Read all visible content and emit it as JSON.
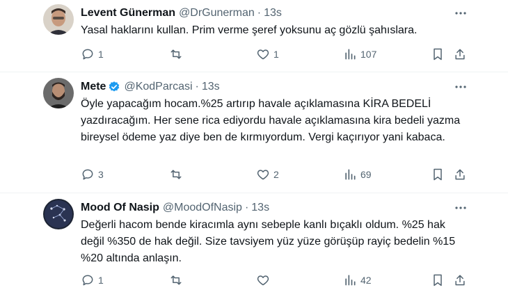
{
  "tweets": [
    {
      "name": "Levent Günerman",
      "handle": "@DrGunerman",
      "dot": "·",
      "time": "13s",
      "lines": [
        "Yasal haklarını kullan. Prim verme şeref yoksunu aç gözlü şahıslara."
      ],
      "replies": "1",
      "retweets": "",
      "likes": "1",
      "views": "107",
      "avatar_color": "#8a6a55"
    },
    {
      "name": "Mete",
      "handle": "@KodParcasi",
      "dot": "·",
      "time": "13s",
      "lines": [
        "Öyle yapacağım hocam.%25 artırıp havale açıklamasına KİRA BEDELİ",
        "yazdıracağım. Her sene rica ediyordu havale açıklamasına kira bedeli yazma",
        "bireysel ödeme yaz diye ben de kırmıyordum. Vergi kaçırıyor yani kabaca."
      ],
      "replies": "3",
      "retweets": "",
      "likes": "2",
      "views": "69",
      "verified_color": "#1d9bf0",
      "avatar_color": "#4b4b4b"
    },
    {
      "name": "Mood Of Nasip",
      "handle": "@MoodOfNasip",
      "dot": "·",
      "time": "13s",
      "lines": [
        "Değerli hacom bende kiracımla aynı sebeple kanlı bıçaklı oldum. %25 hak",
        "değil %350 de hak değil. Size tavsiyem yüz yüze görüşüp rayiç bedelin %15",
        "%20 altında anlaşın."
      ],
      "replies": "1",
      "retweets": "",
      "likes": "",
      "views": "42",
      "avatar_color": "#1d2433"
    }
  ],
  "icons": [
    "more-icon",
    "reply-icon",
    "retweet-icon",
    "like-icon",
    "views-icon",
    "bookmark-icon",
    "share-icon",
    "verified-icon"
  ],
  "colors": {
    "text": "#0f1419",
    "secondary": "#536471",
    "divider": "#eff3f4",
    "accent": "#1d9bf0"
  }
}
